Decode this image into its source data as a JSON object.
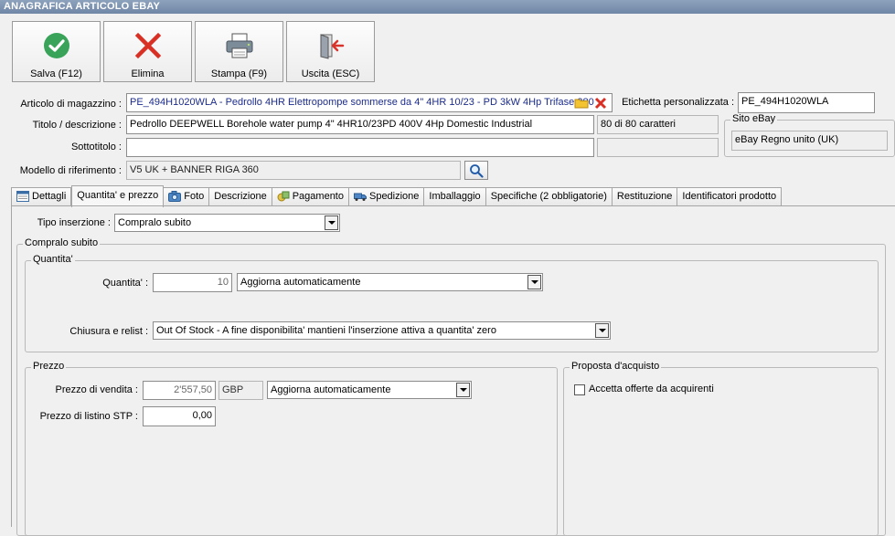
{
  "window": {
    "title": "ANAGRAFICA ARTICOLO EBAY"
  },
  "toolbar": {
    "save_label": "Salva (F12)",
    "delete_label": "Elimina",
    "print_label": "Stampa (F9)",
    "exit_label": "Uscita (ESC)"
  },
  "header": {
    "article_label": "Articolo di magazzino :",
    "article_value": "PE_494H1020WLA - Pedrollo 4HR Elettropompe sommerse da 4\" 4HR 10/23 - PD 3kW 4Hp Trifase 380",
    "custom_label_label": "Etichetta personalizzata :",
    "custom_label_value": "PE_494H1020WLA",
    "title_label": "Titolo / descrizione :",
    "title_value": "Pedrollo DEEPWELL Borehole water pump 4\" 4HR10/23PD 400V 4Hp Domestic Industrial",
    "char_count": "80 di 80 caratteri",
    "subtitle_label": "Sottotitolo :",
    "subtitle_value": "",
    "model_label": "Modello di riferimento :",
    "model_value": "V5 UK + BANNER RIGA 360",
    "site_group_title": "Sito eBay",
    "site_value": "eBay Regno unito (UK)"
  },
  "tabs": [
    {
      "label": "Dettagli",
      "icon": "details-icon"
    },
    {
      "label": "Quantita' e prezzo",
      "icon": ""
    },
    {
      "label": "Foto",
      "icon": "camera-icon"
    },
    {
      "label": "Descrizione",
      "icon": ""
    },
    {
      "label": "Pagamento",
      "icon": "payment-icon"
    },
    {
      "label": "Spedizione",
      "icon": "truck-icon"
    },
    {
      "label": "Imballaggio",
      "icon": ""
    },
    {
      "label": "Specifiche (2 obbligatorie)",
      "icon": ""
    },
    {
      "label": "Restituzione",
      "icon": ""
    },
    {
      "label": "Identificatori prodotto",
      "icon": ""
    }
  ],
  "panel": {
    "listing_type_label": "Tipo inserzione :",
    "listing_type_value": "Compralo subito",
    "buy_now_group": "Compralo subito",
    "quantity_group": "Quantita'",
    "quantity_label": "Quantita' :",
    "quantity_value": "10",
    "quantity_mode": "Aggiorna automaticamente",
    "close_relist_label": "Chiusura e relist :",
    "close_relist_value": "Out Of Stock - A fine disponibilita' mantieni l'inserzione attiva a quantita' zero",
    "price_group": "Prezzo",
    "sale_price_label": "Prezzo di vendita :",
    "sale_price_value": "2'557,50",
    "currency": "GBP",
    "price_mode": "Aggiorna automaticamente",
    "list_price_label": "Prezzo di listino STP :",
    "list_price_value": "0,00",
    "offer_group": "Proposta d'acquisto",
    "accept_offers_label": "Accetta offerte da acquirenti",
    "accept_offers_checked": false
  },
  "colors": {
    "titlebar": "#7b90ae",
    "save_icon": "#3aa35a",
    "delete_icon": "#d93025",
    "exit_icon_arrow": "#d9342b",
    "link_text": "#1c2c8c"
  }
}
